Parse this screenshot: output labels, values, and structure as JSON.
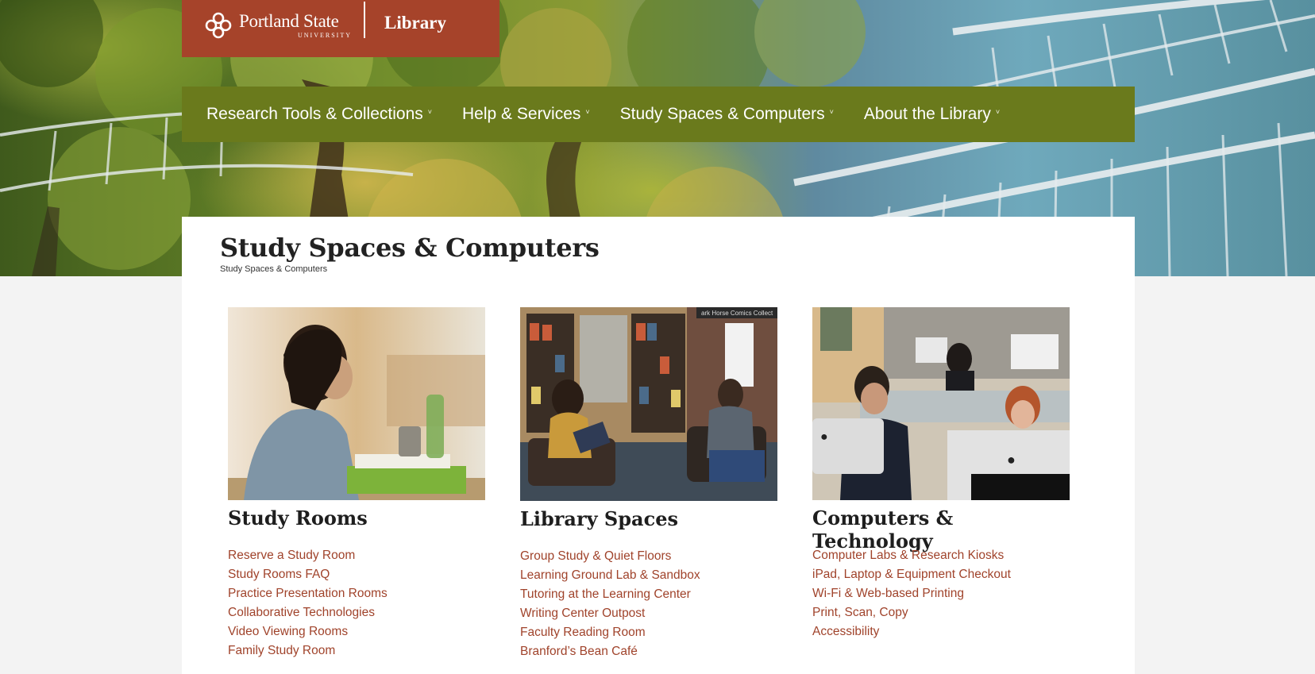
{
  "logo": {
    "name": "Portland State",
    "sub": "UNIVERSITY",
    "library": "Library"
  },
  "nav": {
    "items": [
      {
        "label": "Research Tools & Collections"
      },
      {
        "label": "Help & Services"
      },
      {
        "label": "Study Spaces & Computers"
      },
      {
        "label": "About the Library"
      }
    ],
    "caret": "˅"
  },
  "page": {
    "title": "Study Spaces & Computers",
    "breadcrumb": "Study Spaces & Computers"
  },
  "sections": [
    {
      "title": "Study Rooms",
      "links": [
        "Reserve a Study Room",
        "Study Rooms FAQ",
        "Practice Presentation Rooms",
        "Collaborative Technologies",
        "Video Viewing Rooms",
        "Family Study Room"
      ]
    },
    {
      "title": "Library Spaces",
      "links": [
        "Group Study & Quiet Floors",
        "Learning Ground Lab & Sandbox",
        "Tutoring at the Learning Center",
        "Writing Center Outpost",
        "Faculty Reading Room",
        "Branford’s Bean Café"
      ]
    },
    {
      "title": "Computers & Technology",
      "links": [
        "Computer Labs & Research Kiosks",
        "iPad, Laptop & Equipment Checkout",
        "Wi-Fi & Web-based Printing",
        "Print, Scan, Copy",
        "Accessibility"
      ]
    }
  ],
  "photo_text": {
    "shelf_sign": "ark Horse Comics Collect"
  },
  "colors": {
    "brand_rust": "#a6432a",
    "nav_green": "#6a7a1c",
    "link": "#a0432b"
  }
}
